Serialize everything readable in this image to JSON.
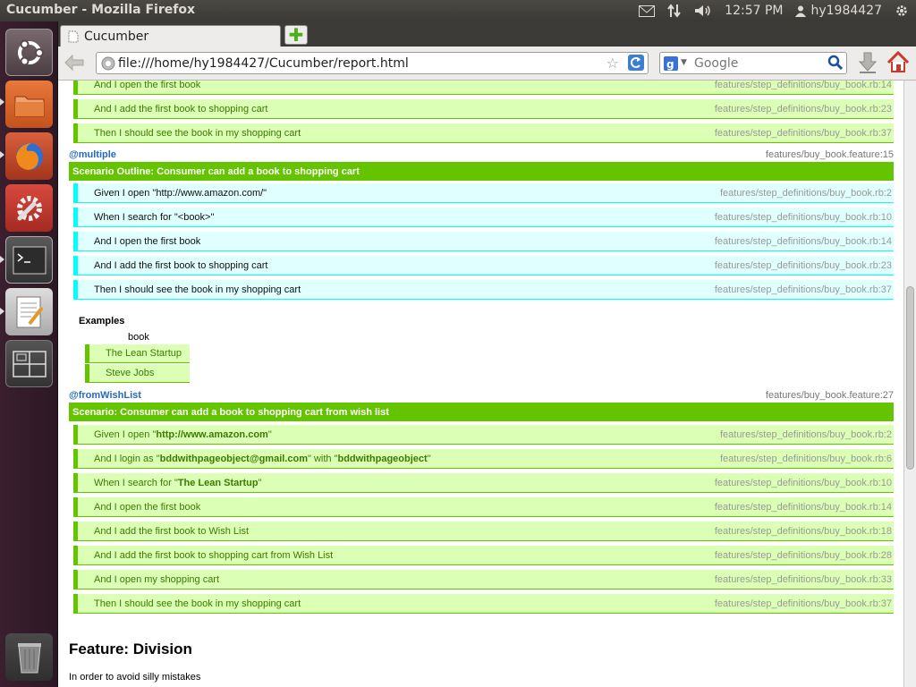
{
  "panel": {
    "window_title": "Cucumber - Mozilla Firefox",
    "clock": "12:57 PM",
    "user": "hy1984427"
  },
  "browser": {
    "tab_title": "Cucumber",
    "url": "file:///home/hy1984427/Cucumber/report.html",
    "search_placeholder": "Google"
  },
  "report": {
    "top_steps": [
      {
        "text": "And I open the first book",
        "loc": "features/step_definitions/buy_book.rb:14"
      },
      {
        "text": "And I add the first book to shopping cart",
        "loc": "features/step_definitions/buy_book.rb:23"
      },
      {
        "text": "Then I should see the book in my shopping cart",
        "loc": "features/step_definitions/buy_book.rb:37"
      }
    ],
    "outline": {
      "tag": "@multiple",
      "loc": "features/buy_book.feature:15",
      "title": "Scenario Outline: Consumer can add a book to shopping cart",
      "steps": [
        {
          "text": "Given I open \"http://www.amazon.com/\"",
          "loc": "features/step_definitions/buy_book.rb:2"
        },
        {
          "text": "When I search for \"<book>\"",
          "loc": "features/step_definitions/buy_book.rb:10"
        },
        {
          "text": "And I open the first book",
          "loc": "features/step_definitions/buy_book.rb:14"
        },
        {
          "text": "And I add the first book to shopping cart",
          "loc": "features/step_definitions/buy_book.rb:23"
        },
        {
          "text": "Then I should see the book in my shopping cart",
          "loc": "features/step_definitions/buy_book.rb:37"
        }
      ],
      "examples_title": "Examples",
      "examples_header": "book",
      "examples_rows": [
        "The Lean Startup",
        "Steve Jobs"
      ]
    },
    "wishlist": {
      "tag": "@fromWishList",
      "loc": "features/buy_book.feature:27",
      "title": "Scenario: Consumer can add a book to shopping cart from wish list",
      "step1_pre": "Given I open \"",
      "step1_arg": "http://www.amazon.com",
      "step1_post": "\"",
      "step1_loc": "features/step_definitions/buy_book.rb:2",
      "step2_pre": "And I login as \"",
      "step2_arg1": "bddwithpageobject@gmail.com",
      "step2_mid": "\" with \"",
      "step2_arg2": "bddwithpageobject",
      "step2_post": "\"",
      "step2_loc": "features/step_definitions/buy_book.rb:6",
      "step3_pre": "When I search for \"",
      "step3_arg": "The Lean Startup",
      "step3_post": "\"",
      "step3_loc": "features/step_definitions/buy_book.rb:10",
      "steps": [
        {
          "text": "And I open the first book",
          "loc": "features/step_definitions/buy_book.rb:14"
        },
        {
          "text": "And I add the first book to Wish List",
          "loc": "features/step_definitions/buy_book.rb:18"
        },
        {
          "text": "And I add the first book to shopping cart from Wish List",
          "loc": "features/step_definitions/buy_book.rb:28"
        },
        {
          "text": "And I open my shopping cart",
          "loc": "features/step_definitions/buy_book.rb:33"
        },
        {
          "text": "Then I should see the book in my shopping cart",
          "loc": "features/step_definitions/buy_book.rb:37"
        }
      ]
    },
    "feature_title": "Feature: Division",
    "feature_desc": "In order to avoid silly mistakes"
  }
}
